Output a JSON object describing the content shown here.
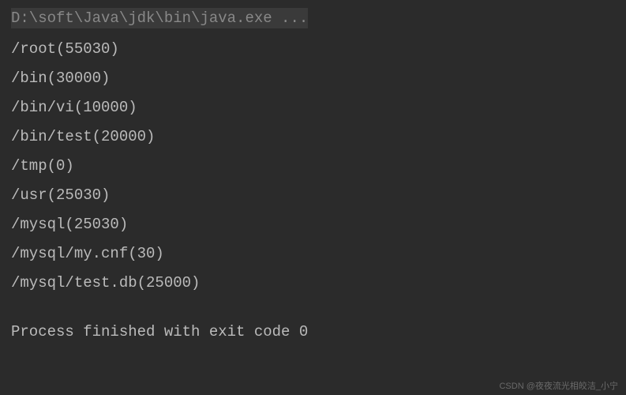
{
  "command": "D:\\soft\\Java\\jdk\\bin\\java.exe ...",
  "output_lines": [
    "/root(55030)",
    "/bin(30000)",
    "/bin/vi(10000)",
    "/bin/test(20000)",
    "/tmp(0)",
    "/usr(25030)",
    "/mysql(25030)",
    "/mysql/my.cnf(30)",
    "/mysql/test.db(25000)"
  ],
  "exit_message": "Process finished with exit code 0",
  "watermark": "CSDN @夜夜流光相皎洁_小宁"
}
